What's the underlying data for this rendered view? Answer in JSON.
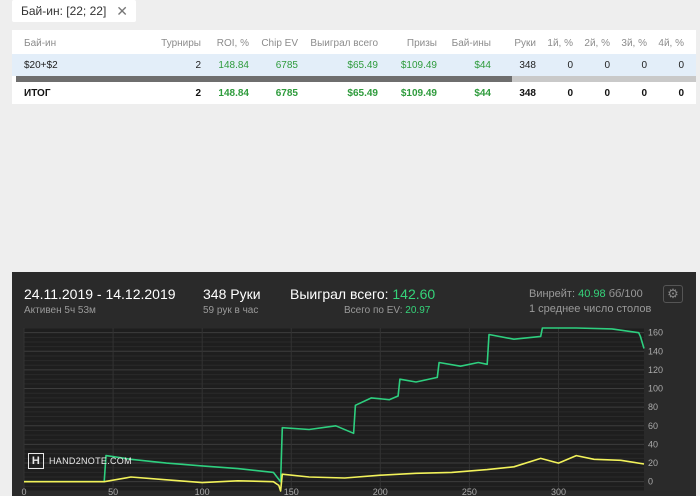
{
  "filter": {
    "label": "Бай-ин: [22; 22]",
    "close_icon": "✕"
  },
  "table": {
    "columns": [
      "Бай-ин",
      "Турниры",
      "ROI, %",
      "Chip EV",
      "Выиграл всего",
      "Призы",
      "Бай-ины",
      "Руки",
      "1й, %",
      "2й, %",
      "3й, %",
      "4й, %"
    ],
    "rows": [
      [
        "$20+$2",
        "2",
        "148.84",
        "6785",
        "$65.49",
        "$109.49",
        "$44",
        "348",
        "0",
        "0",
        "0",
        "0"
      ]
    ],
    "total": [
      "ИТОГ",
      "2",
      "148.84",
      "6785",
      "$65.49",
      "$109.49",
      "$44",
      "348",
      "0",
      "0",
      "0",
      "0"
    ]
  },
  "summary": {
    "date_range": "24.11.2019 - 14.12.2019",
    "active": "Активен 5ч 53м",
    "hands": "348 Руки",
    "hands_rate": "59 рук в час",
    "won_label": "Выиграл всего:",
    "won_value": "142.60",
    "ev_label": "Всего по EV:",
    "ev_value": "20.97",
    "winrate_label": "Винрейт:",
    "winrate_value": "40.98",
    "winrate_unit": "бб/100",
    "tables_label": "1 среднее число столов",
    "gear_icon": "⚙"
  },
  "logo": {
    "text": "HAND2NOTE.COM",
    "mark": "H"
  },
  "colors": {
    "green_line": "#2ecf7f",
    "yellow_line": "#f2f25a",
    "accent_green": "#35d47a"
  },
  "chart_data": {
    "type": "line",
    "xlim": [
      0,
      348
    ],
    "ylim": [
      -10,
      165
    ],
    "x_ticks": [
      0,
      50,
      100,
      150,
      200,
      250,
      300
    ],
    "y_ticks": [
      0,
      20,
      40,
      60,
      80,
      100,
      120,
      140,
      160
    ],
    "grid": true,
    "series": [
      {
        "color": "#2ecf7f",
        "x": [
          0,
          45,
          46,
          60,
          80,
          100,
          120,
          140,
          144,
          145,
          160,
          175,
          185,
          186,
          195,
          205,
          210,
          211,
          220,
          232,
          233,
          245,
          255,
          260,
          261,
          275,
          290,
          291,
          310,
          330,
          345,
          346,
          348
        ],
        "y": [
          0,
          0,
          28,
          24,
          20,
          17,
          14,
          10,
          0,
          58,
          56,
          60,
          52,
          82,
          90,
          88,
          92,
          110,
          107,
          112,
          128,
          124,
          128,
          126,
          158,
          153,
          156,
          170,
          166,
          164,
          160,
          156,
          143
        ]
      },
      {
        "color": "#f2f25a",
        "x": [
          0,
          45,
          60,
          80,
          100,
          120,
          140,
          143,
          144,
          145,
          160,
          180,
          200,
          220,
          240,
          260,
          275,
          290,
          300,
          310,
          320,
          335,
          348
        ],
        "y": [
          0,
          0,
          5,
          2,
          -1,
          1,
          0,
          -4,
          -10,
          8,
          5,
          4,
          7,
          9,
          10,
          13,
          16,
          25,
          20,
          28,
          24,
          23,
          19
        ]
      }
    ]
  }
}
